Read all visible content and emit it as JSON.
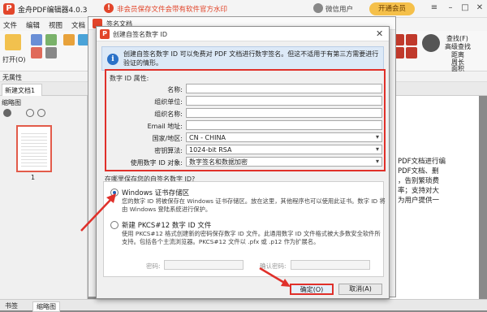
{
  "app": {
    "title": "金舟PDF编辑器4.0.3",
    "notice": "非会员保存文件会带有软件官方水印",
    "user": "微信用户",
    "vip_button": "开通会员"
  },
  "menu": [
    "文件",
    "编辑",
    "视图",
    "文档",
    "注释",
    "窗口",
    "帮助"
  ],
  "ribbon": {
    "open_label": "打开(O)",
    "right_labels": [
      "查找(F)",
      "高级查找",
      "距离",
      "周长",
      "面积"
    ]
  },
  "status_label": "无属性",
  "doc_tab": "新建文档1",
  "left_panel": {
    "header": "缩略图",
    "page_number": "1"
  },
  "bottom_tabs": [
    "书签",
    "缩略图"
  ],
  "doc_text": [
    "PDF文档进行编",
    "PDF文档、删",
    "，告别繁琐费",
    "率；支持对大",
    "为用户提供一"
  ],
  "bg_dialog_title": "签名文档",
  "dialog": {
    "title": "创建自签名数字 ID",
    "info": "创建自签名数字 ID 可以免费对 PDF 文档进行数字签名。但这不适用于有第三方需要进行验证的情形。",
    "props_legend": "数字 ID 属性:",
    "fields": [
      {
        "label": "名称:",
        "value": "",
        "select": false
      },
      {
        "label": "组织单位:",
        "value": "",
        "select": false
      },
      {
        "label": "组织名称:",
        "value": "",
        "select": false
      },
      {
        "label": "Email 地址:",
        "value": "",
        "select": false
      },
      {
        "label": "国家/地区:",
        "value": "CN - CHINA",
        "select": true
      },
      {
        "label": "密钥算法:",
        "value": "1024-bit RSA",
        "select": true
      },
      {
        "label": "使用数字 ID 对象:",
        "value": "数字签名和数据加密",
        "select": true
      }
    ],
    "store_label": "在哪里保存您的自签名数字 ID?",
    "option1_title": "Windows 证书存储区",
    "option1_desc": "您的数字 ID 将被保存在 Windows 证书存储区。放在这里，其他程序也可以使用此证书。数字 ID 将由 Windows 登陆系统进行保护。",
    "option2_title": "新建 PKCS#12 数字 ID 文件",
    "option2_desc": "使用 PKCS#12 格式创建新的密码保存数字 ID 文件。此通用数字 ID 文件格式被大多数安全软件所支持。包括各个主流浏览器。PKCS#12 文件以 .pfx 或 .p12 作为扩展名。",
    "password_label": "密码:",
    "confirm_label": "确认密码:",
    "ok_label": "确定(O)",
    "cancel_label": "取消(A)"
  }
}
